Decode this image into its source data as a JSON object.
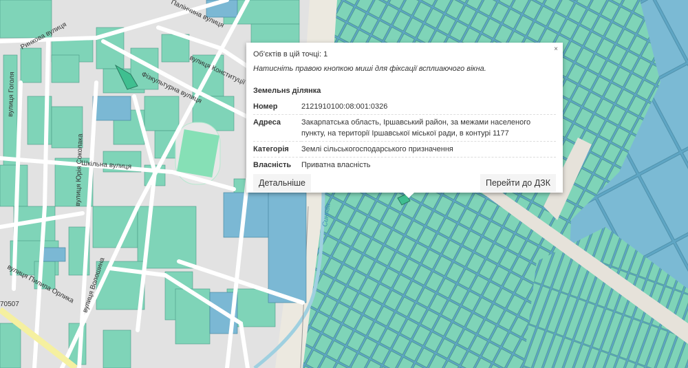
{
  "popup": {
    "close_label": "×",
    "objects_count": "Об'єктів в цій точці: 1",
    "hint": "Натисніть правою кнопкою миші для фіксації всплиаючого вікна.",
    "section_title": "Земельнs ділянка",
    "rows": [
      {
        "key": "Номер",
        "value": "2121910100:08:001:0326"
      },
      {
        "key": "Адреса",
        "value": "Закарпатська область, Іршавський район, за межами населеного пункту, на території Іршавської міської ради, в контурі 1177"
      },
      {
        "key": "Категорія",
        "value": "Землі сільськогосподарського призначення"
      },
      {
        "key": "Власність",
        "value": "Приватна власність"
      }
    ],
    "details_button": "Детальніше",
    "dzk_button": "Перейти до ДЗК"
  },
  "map": {
    "streets": [
      "Ринкова вулиця",
      "Палінчина вулиця",
      "вулиця Гоголя",
      "вулиця Конституції",
      "Фізкультурна вулиця",
      "Шкільна вулиця",
      "вулиця Юрія Соколака",
      "вулиця Волошина",
      "вулиця Пилипа Орлика",
      "Синява"
    ],
    "road_number": "70507"
  },
  "colors": {
    "parcel": "#7fd4b8",
    "parcel_blue": "#7bb8d4",
    "background": "#e2e2e2",
    "road": "#ffffff"
  }
}
